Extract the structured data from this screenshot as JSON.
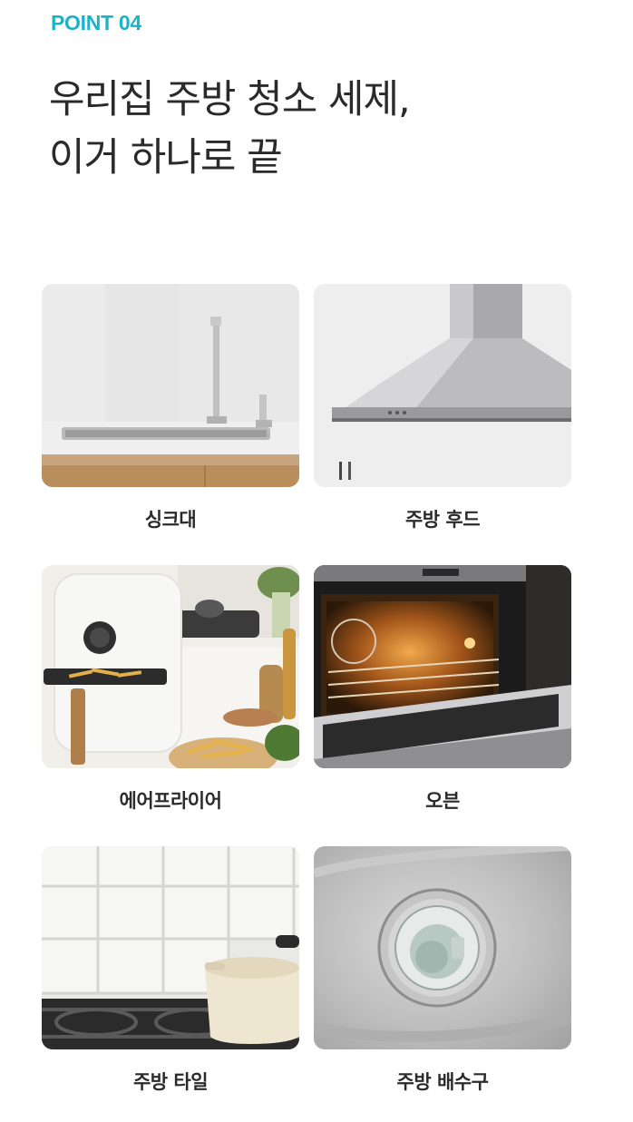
{
  "eyebrow": "POINT 04",
  "headline": {
    "line1": "우리집 주방 청소 세제,",
    "line2": "이거 하나로 끝"
  },
  "items": [
    {
      "label": "싱크대",
      "image": "kitchen-sink-photo"
    },
    {
      "label": "주방 후드",
      "image": "range-hood-photo"
    },
    {
      "label": "에어프라이어",
      "image": "air-fryer-photo"
    },
    {
      "label": "오븐",
      "image": "oven-photo"
    },
    {
      "label": "주방 타일",
      "image": "kitchen-tile-photo"
    },
    {
      "label": "주방 배수구",
      "image": "sink-drain-photo"
    }
  ]
}
